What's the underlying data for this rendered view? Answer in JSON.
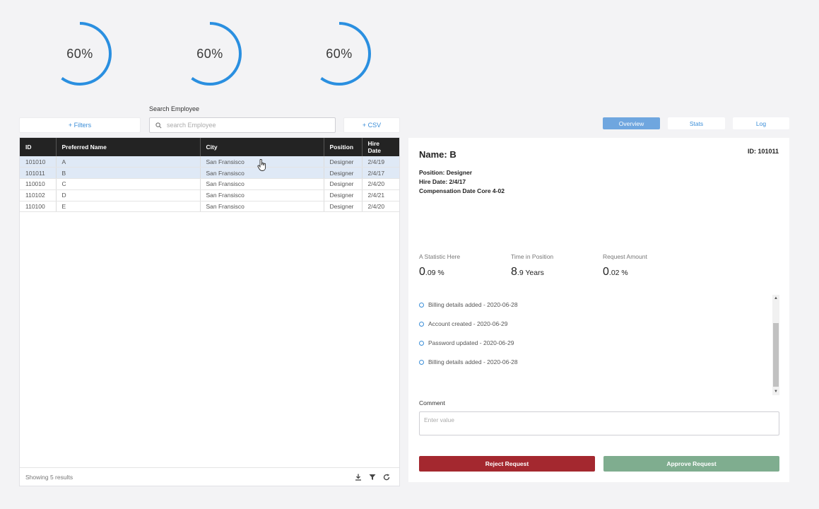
{
  "gauges": [
    {
      "label": "60%",
      "fraction": 0.6
    },
    {
      "label": "60%",
      "fraction": 0.6
    },
    {
      "label": "60%",
      "fraction": 0.6
    }
  ],
  "colors": {
    "accent": "#2a8fe0",
    "header_bg": "#232323",
    "selected_row": "#dfe9f6",
    "reject": "#a4282f",
    "approve": "#7fad8f"
  },
  "toolbar": {
    "filters_label": "+ Filters",
    "search_label": "Search Employee",
    "search_placeholder": "search Employee",
    "csv_label": "+ CSV"
  },
  "table": {
    "columns": [
      "ID",
      "Preferred Name",
      "City",
      "Position",
      "Hire Date"
    ],
    "rows": [
      {
        "id": "101010",
        "name": "A",
        "city": "San Fransisco",
        "position": "Designer",
        "hire": "2/4/19"
      },
      {
        "id": "101011",
        "name": "B",
        "city": "San Fransisco",
        "position": "Designer",
        "hire": "2/4/17"
      },
      {
        "id": "110010",
        "name": "C",
        "city": "San Fransisco",
        "position": "Designer",
        "hire": "2/4/20"
      },
      {
        "id": "110102",
        "name": "D",
        "city": "San Fransisco",
        "position": "Designer",
        "hire": "2/4/21"
      },
      {
        "id": "110100",
        "name": "E",
        "city": "San Fransisco",
        "position": "Designer",
        "hire": "2/4/20"
      }
    ],
    "footer": "Showing 5 results"
  },
  "tabs": [
    "Overview",
    "Stats",
    "Log"
  ],
  "detail": {
    "name": "Name: B",
    "id": "ID: 101011",
    "position": "Position: Designer",
    "hire_date": "Hire Date: 2/4/17",
    "comp": "Compensation Date Core 4-02",
    "stats": [
      {
        "label": "A Statistic Here",
        "big": "0",
        "small": ".09 %"
      },
      {
        "label": "Time in Position",
        "big": "8",
        "small": ".9 Years"
      },
      {
        "label": "Request Amount",
        "big": "0",
        "small": ".02 %"
      }
    ],
    "timeline": [
      "Billing details added - 2020-06-28",
      "Account created - 2020-06-29",
      "Password updated - 2020-06-29",
      "Billing details added - 2020-06-28"
    ],
    "comment_label": "Comment",
    "comment_placeholder": "Enter value",
    "reject_label": "Reject Request",
    "approve_label": "Approve Request"
  }
}
